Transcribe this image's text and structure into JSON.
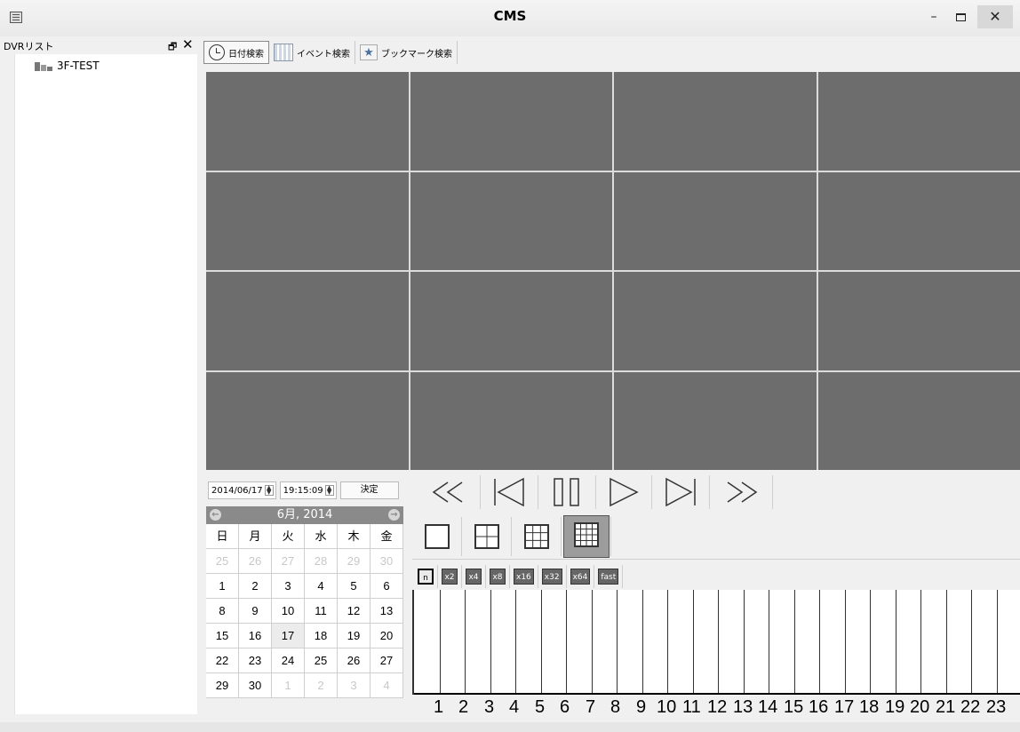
{
  "window": {
    "title": "CMS",
    "minimize": "–",
    "close": "✕"
  },
  "sidebar": {
    "title": "DVRリスト",
    "restore_glyph": "🗗",
    "close_glyph": "✕",
    "tree": [
      {
        "label": "3F-TEST",
        "icon": "dvr-group-icon"
      }
    ]
  },
  "toolbar": {
    "tabs": [
      {
        "label": "日付検索",
        "icon": "clock-icon",
        "active": true
      },
      {
        "label": "イベント検索",
        "icon": "calendar-grid-icon",
        "active": false
      },
      {
        "label": "ブックマーク検索",
        "icon": "bookmark-star-icon",
        "active": false
      }
    ]
  },
  "search": {
    "date": "2014/06/17",
    "time": "19:15:09",
    "decide_label": "決定"
  },
  "calendar": {
    "month_label": "6月, 2014",
    "weekdays": [
      "日",
      "月",
      "火",
      "水",
      "木",
      "金"
    ],
    "weeks": [
      [
        "25",
        "26",
        "27",
        "28",
        "29",
        "30"
      ],
      [
        "1",
        "2",
        "3",
        "4",
        "5",
        "6"
      ],
      [
        "8",
        "9",
        "10",
        "11",
        "12",
        "13"
      ],
      [
        "15",
        "16",
        "17",
        "18",
        "19",
        "20"
      ],
      [
        "22",
        "23",
        "24",
        "25",
        "26",
        "27"
      ],
      [
        "29",
        "30",
        "1",
        "2",
        "3",
        "4"
      ]
    ],
    "dimmed": [
      [
        0,
        0
      ],
      [
        0,
        1
      ],
      [
        0,
        2
      ],
      [
        0,
        3
      ],
      [
        0,
        4
      ],
      [
        0,
        5
      ],
      [
        5,
        2
      ],
      [
        5,
        3
      ],
      [
        5,
        4
      ],
      [
        5,
        5
      ]
    ],
    "selected": [
      3,
      2
    ]
  },
  "playback": {
    "buttons": [
      "fast-rewind",
      "step-back",
      "pause",
      "play",
      "step-forward",
      "fast-forward"
    ]
  },
  "layout": {
    "buttons": [
      {
        "name": "layout-1x1",
        "division": 1,
        "active": false
      },
      {
        "name": "layout-2x2",
        "division": 2,
        "active": false
      },
      {
        "name": "layout-3x3",
        "division": 3,
        "active": false
      },
      {
        "name": "layout-4x4",
        "division": 4,
        "active": true
      }
    ]
  },
  "speeds": [
    {
      "label": "n",
      "active": true
    },
    {
      "label": "x2",
      "active": false
    },
    {
      "label": "x4",
      "active": false
    },
    {
      "label": "x8",
      "active": false
    },
    {
      "label": "x16",
      "active": false
    },
    {
      "label": "x32",
      "active": false
    },
    {
      "label": "x64",
      "active": false
    },
    {
      "label": "fast",
      "active": false
    }
  ],
  "timeline": {
    "hours": [
      "1",
      "2",
      "3",
      "4",
      "5",
      "6",
      "7",
      "8",
      "9",
      "10",
      "11",
      "12",
      "13",
      "14",
      "15",
      "16",
      "17",
      "18",
      "19",
      "20",
      "21",
      "22",
      "23"
    ]
  },
  "video": {
    "tiles": 16
  }
}
